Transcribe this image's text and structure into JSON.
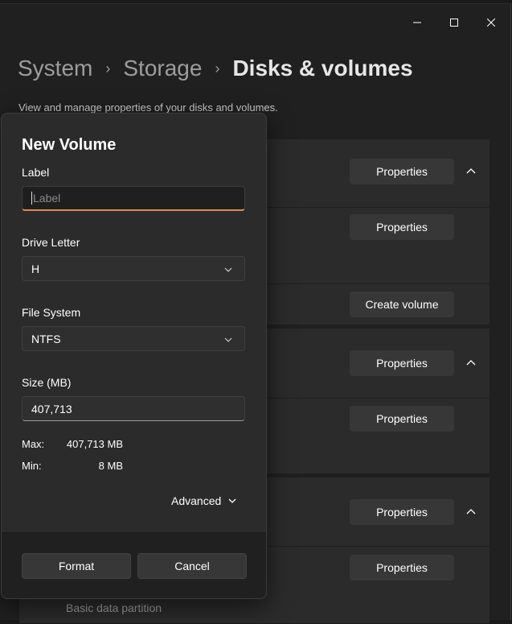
{
  "window": {
    "caption": {
      "minimize": "minimize",
      "maximize": "maximize",
      "close": "close"
    }
  },
  "breadcrumb": {
    "items": [
      "System",
      "Storage",
      "Disks & volumes"
    ],
    "separator": "›"
  },
  "subtitle": "View and manage properties of your disks and volumes.",
  "background": {
    "properties_label": "Properties",
    "create_volume_label": "Create volume",
    "partition_text": "Basic data partition"
  },
  "dialog": {
    "title": "New Volume",
    "label_field": {
      "label": "Label",
      "value": "",
      "placeholder": "Label"
    },
    "drive_letter": {
      "label": "Drive Letter",
      "value": "H"
    },
    "file_system": {
      "label": "File System",
      "value": "NTFS"
    },
    "size": {
      "label": "Size (MB)",
      "value": "407,713"
    },
    "max": {
      "label": "Max:",
      "value": "407,713 MB"
    },
    "min": {
      "label": "Min:",
      "value": "8 MB"
    },
    "advanced_label": "Advanced",
    "format_button": "Format",
    "cancel_button": "Cancel"
  },
  "colors": {
    "accent": "#e2884e",
    "window_bg": "#202020",
    "card_bg": "#2b2b2b",
    "button_bg": "#373737"
  },
  "icons": [
    "minimize-icon",
    "maximize-icon",
    "close-icon",
    "chevron-right-icon",
    "chevron-up-icon",
    "chevron-down-icon"
  ]
}
